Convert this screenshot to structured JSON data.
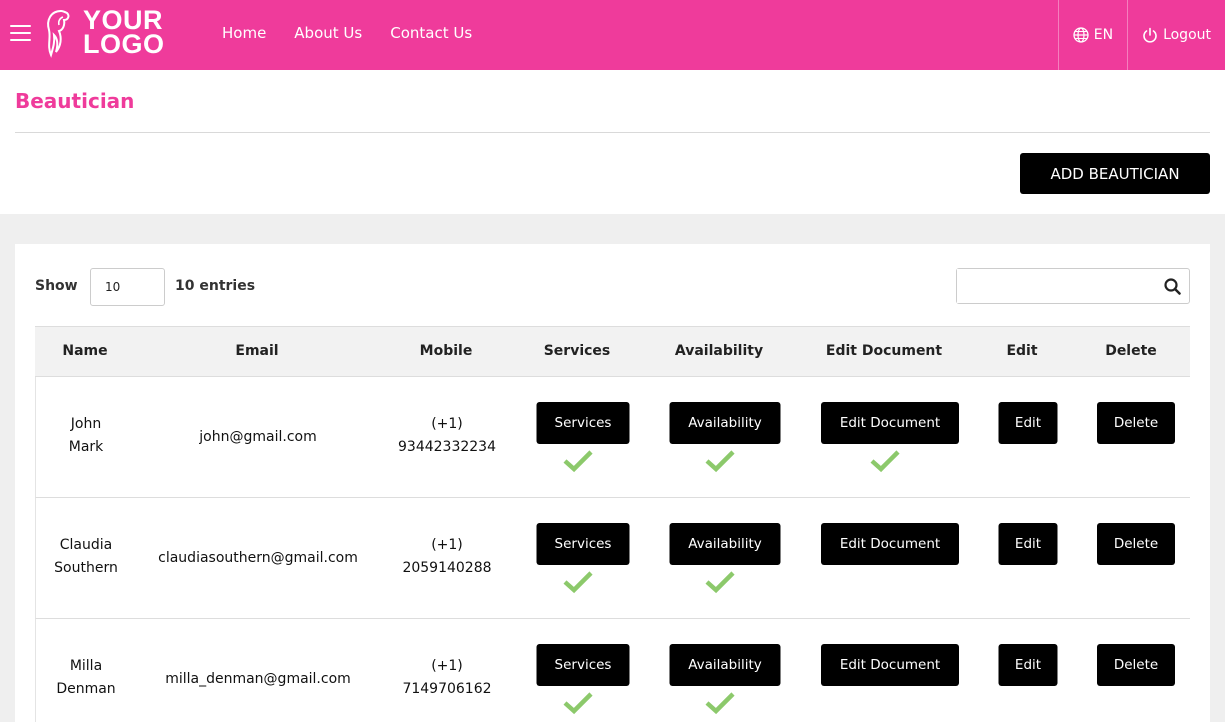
{
  "header": {
    "logo_line1": "YOUR",
    "logo_line2": "LOGO",
    "nav": [
      "Home",
      "About Us",
      "Contact Us"
    ],
    "language": "EN",
    "logout": "Logout"
  },
  "page": {
    "title": "Beautician",
    "add_button": "ADD BEAUTICIAN"
  },
  "table_controls": {
    "show_label": "Show",
    "entries_value": "10",
    "entries_label": "10 entries",
    "search_value": ""
  },
  "columns": [
    "Name",
    "Email",
    "Mobile",
    "Services",
    "Availability",
    "Edit Document",
    "Edit",
    "Delete"
  ],
  "buttons": {
    "services": "Services",
    "availability": "Availability",
    "edit_document": "Edit Document",
    "edit": "Edit",
    "delete": "Delete"
  },
  "rows": [
    {
      "first": "John",
      "last": "Mark",
      "email": "john@gmail.com",
      "code": "(+1)",
      "phone": "93442332234",
      "services_ok": true,
      "availability_ok": true,
      "document_ok": true
    },
    {
      "first": "Claudia",
      "last": "Southern",
      "email": "claudiasouthern@gmail.com",
      "code": "(+1)",
      "phone": "2059140288",
      "services_ok": true,
      "availability_ok": true,
      "document_ok": false
    },
    {
      "first": "Milla",
      "last": "Denman",
      "email": "milla_denman@gmail.com",
      "code": "(+1)",
      "phone": "7149706162",
      "services_ok": true,
      "availability_ok": true,
      "document_ok": false
    }
  ],
  "colors": {
    "brand": "#ef3b9b",
    "check": "#8cc96b",
    "button": "#000000"
  }
}
